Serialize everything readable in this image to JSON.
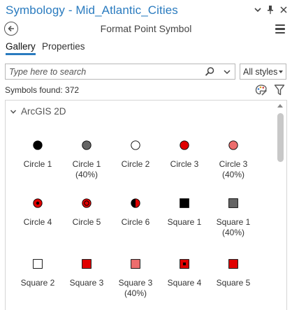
{
  "window": {
    "title": "Symbology - Mid_Atlantic_Cities",
    "subtitle": "Format Point Symbol"
  },
  "tabs": [
    {
      "label": "Gallery",
      "active": true
    },
    {
      "label": "Properties",
      "active": false
    }
  ],
  "search": {
    "placeholder": "Type here to search",
    "value": ""
  },
  "styles_filter": {
    "selected": "All styles"
  },
  "symbols_found": "Symbols found: 372",
  "gallery": {
    "group": "ArcGIS 2D",
    "expanded": true,
    "symbols": [
      {
        "name": "Circle 1",
        "shape": "circle",
        "fill": "#000000"
      },
      {
        "name": "Circle 1\n(40%)",
        "shape": "circle",
        "fill": "#646464"
      },
      {
        "name": "Circle 2",
        "shape": "circle",
        "fill": "#ffffff"
      },
      {
        "name": "Circle 3",
        "shape": "circle",
        "fill": "#e00000"
      },
      {
        "name": "Circle 3\n(40%)",
        "shape": "circle",
        "fill": "#ec6d6d"
      },
      {
        "name": "Circle 4",
        "shape": "circle-dot",
        "fill": "#e00000"
      },
      {
        "name": "Circle 5",
        "shape": "circle-ring",
        "fill": "#e00000"
      },
      {
        "name": "Circle 6",
        "shape": "circle-half",
        "fill": "#e00000"
      },
      {
        "name": "Square 1",
        "shape": "square",
        "fill": "#000000"
      },
      {
        "name": "Square 1\n(40%)",
        "shape": "square",
        "fill": "#646464"
      },
      {
        "name": "Square 2",
        "shape": "square",
        "fill": "#ffffff"
      },
      {
        "name": "Square 3",
        "shape": "square",
        "fill": "#e00000"
      },
      {
        "name": "Square 3\n(40%)",
        "shape": "square",
        "fill": "#ec6d6d"
      },
      {
        "name": "Square 4",
        "shape": "square-dot",
        "fill": "#e00000"
      },
      {
        "name": "Square 5",
        "shape": "square",
        "fill": "#e00000"
      }
    ]
  },
  "icons": {
    "back": "back-arrow-icon",
    "menu": "hamburger-menu-icon",
    "options": "options-chevron-icon",
    "pin": "auto-hide-pin-icon",
    "close": "close-icon",
    "search": "search-icon",
    "style_palette": "style-palette-icon",
    "filter": "filter-icon"
  },
  "colors": {
    "title": "#2a7bbf",
    "tab_underline": "#2a7bbf",
    "symbol_red": "#e00000",
    "symbol_light_red": "#ec6d6d",
    "symbol_gray": "#646464"
  }
}
